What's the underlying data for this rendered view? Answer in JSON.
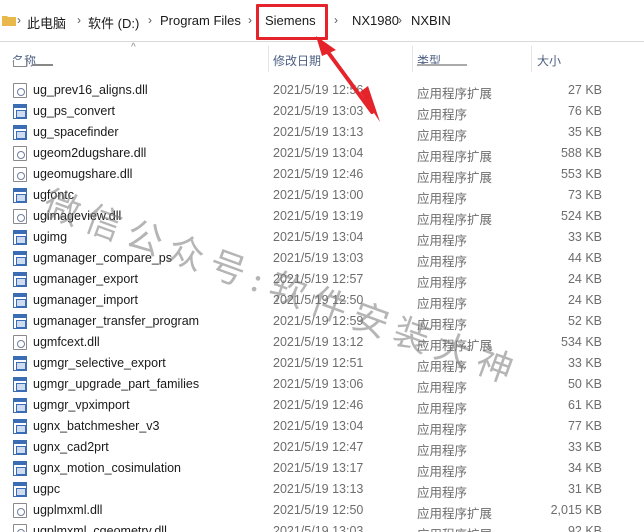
{
  "breadcrumb": {
    "items": [
      "此电脑",
      "软件 (D:)",
      "Program Files",
      "Siemens",
      "NX1980",
      "NXBIN"
    ]
  },
  "columns": {
    "name": "名称",
    "date": "修改日期",
    "type": "类型",
    "size": "大小"
  },
  "files": [
    {
      "name": "ug_prev16_aligns.dll",
      "date": "2021/5/19 12:56",
      "type": "应用程序扩展",
      "size": "27 KB",
      "icon": "dll-icon"
    },
    {
      "name": "ug_ps_convert",
      "date": "2021/5/19 13:03",
      "type": "应用程序",
      "size": "76 KB",
      "icon": "exe-icon"
    },
    {
      "name": "ug_spacefinder",
      "date": "2021/5/19 13:13",
      "type": "应用程序",
      "size": "35 KB",
      "icon": "exe-icon"
    },
    {
      "name": "ugeom2dugshare.dll",
      "date": "2021/5/19 13:04",
      "type": "应用程序扩展",
      "size": "588 KB",
      "icon": "dll-icon"
    },
    {
      "name": "ugeomugshare.dll",
      "date": "2021/5/19 12:46",
      "type": "应用程序扩展",
      "size": "553 KB",
      "icon": "dll-icon"
    },
    {
      "name": "ugfontc",
      "date": "2021/5/19 13:00",
      "type": "应用程序",
      "size": "73 KB",
      "icon": "exe-icon"
    },
    {
      "name": "ugimageview.dll",
      "date": "2021/5/19 13:19",
      "type": "应用程序扩展",
      "size": "524 KB",
      "icon": "dll-icon"
    },
    {
      "name": "ugimg",
      "date": "2021/5/19 13:04",
      "type": "应用程序",
      "size": "33 KB",
      "icon": "exe-icon"
    },
    {
      "name": "ugmanager_compare_ps",
      "date": "2021/5/19 13:03",
      "type": "应用程序",
      "size": "44 KB",
      "icon": "exe-icon"
    },
    {
      "name": "ugmanager_export",
      "date": "2021/5/19 12:57",
      "type": "应用程序",
      "size": "24 KB",
      "icon": "exe-icon"
    },
    {
      "name": "ugmanager_import",
      "date": "2021/5/19 12:50",
      "type": "应用程序",
      "size": "24 KB",
      "icon": "exe-icon"
    },
    {
      "name": "ugmanager_transfer_program",
      "date": "2021/5/19 12:59",
      "type": "应用程序",
      "size": "52 KB",
      "icon": "exe-icon"
    },
    {
      "name": "ugmfcext.dll",
      "date": "2021/5/19 13:12",
      "type": "应用程序扩展",
      "size": "534 KB",
      "icon": "dll-icon"
    },
    {
      "name": "ugmgr_selective_export",
      "date": "2021/5/19 12:51",
      "type": "应用程序",
      "size": "33 KB",
      "icon": "exe-icon"
    },
    {
      "name": "ugmgr_upgrade_part_families",
      "date": "2021/5/19 13:06",
      "type": "应用程序",
      "size": "50 KB",
      "icon": "exe-icon"
    },
    {
      "name": "ugmgr_vpximport",
      "date": "2021/5/19 12:46",
      "type": "应用程序",
      "size": "61 KB",
      "icon": "exe-icon"
    },
    {
      "name": "ugnx_batchmesher_v3",
      "date": "2021/5/19 13:04",
      "type": "应用程序",
      "size": "77 KB",
      "icon": "exe-icon"
    },
    {
      "name": "ugnx_cad2prt",
      "date": "2021/5/19 12:47",
      "type": "应用程序",
      "size": "33 KB",
      "icon": "exe-icon"
    },
    {
      "name": "ugnx_motion_cosimulation",
      "date": "2021/5/19 13:17",
      "type": "应用程序",
      "size": "34 KB",
      "icon": "exe-icon"
    },
    {
      "name": "ugpc",
      "date": "2021/5/19 13:13",
      "type": "应用程序",
      "size": "31 KB",
      "icon": "exe-icon"
    },
    {
      "name": "ugplmxml.dll",
      "date": "2021/5/19 12:50",
      "type": "应用程序扩展",
      "size": "2,015 KB",
      "icon": "dll-icon"
    },
    {
      "name": "ugplmxml_cgeometry.dll",
      "date": "2021/5/19 13:03",
      "type": "应用程序扩展",
      "size": "92 KB",
      "icon": "dll-icon"
    }
  ],
  "watermark": "微信公众号:软件安装大神",
  "colors": {
    "highlight": "#e5232a",
    "header_text": "#4d6082",
    "secondary_text": "#6d6d6d",
    "folder": "#e8b84a"
  }
}
